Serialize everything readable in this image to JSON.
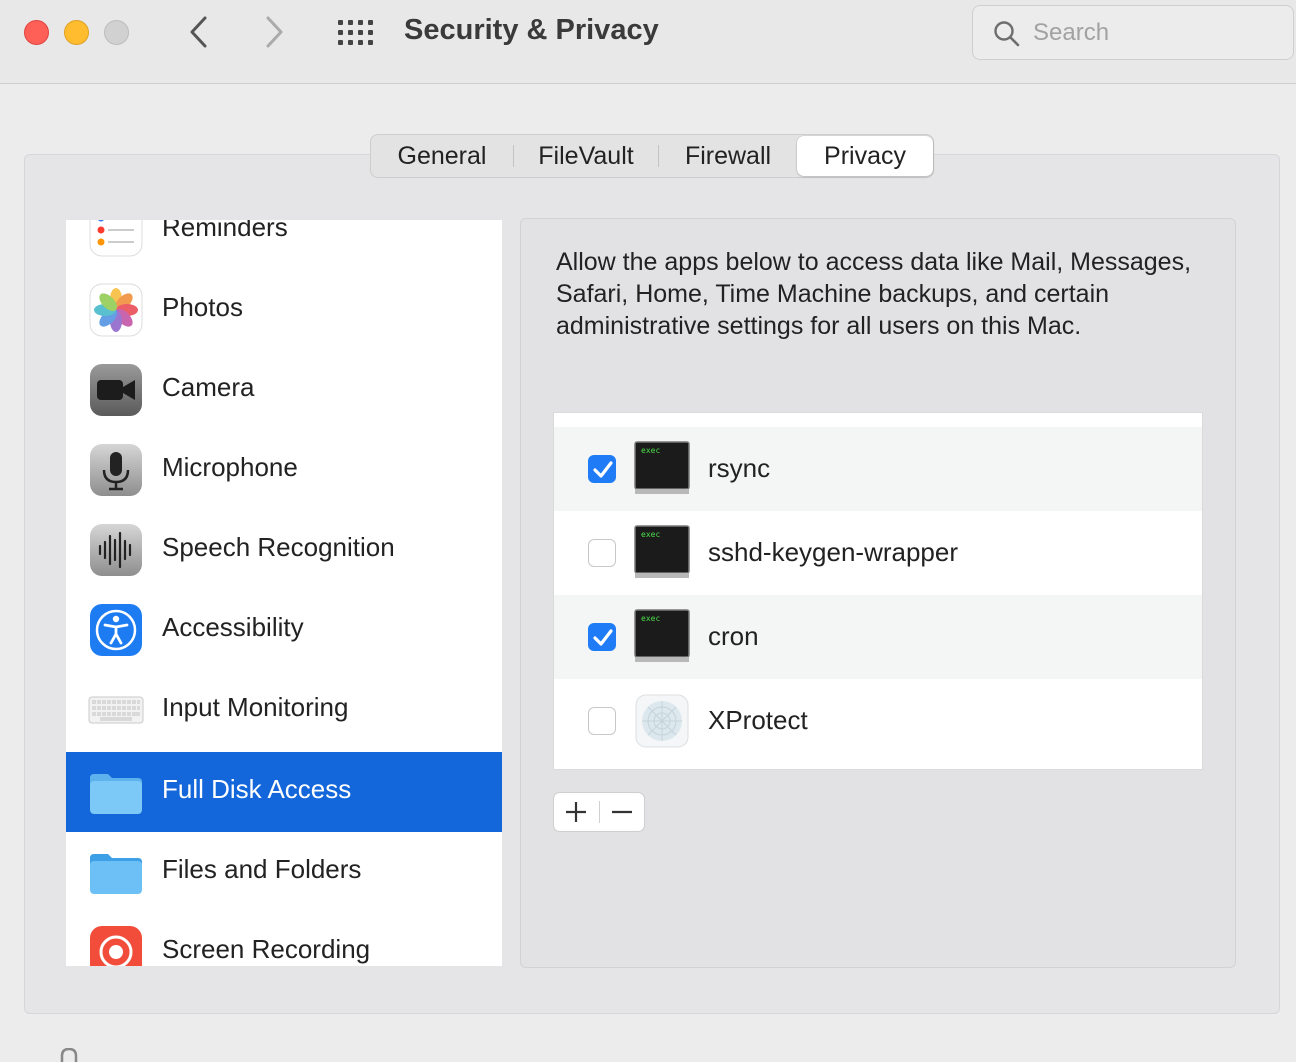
{
  "window": {
    "title": "Security & Privacy",
    "search_placeholder": "Search"
  },
  "tabs": [
    {
      "label": "General"
    },
    {
      "label": "FileVault"
    },
    {
      "label": "Firewall"
    },
    {
      "label": "Privacy",
      "selected": true
    }
  ],
  "sidebar": {
    "selected": "Full Disk Access",
    "items": [
      {
        "label": "Reminders",
        "icon": "reminders-icon"
      },
      {
        "label": "Photos",
        "icon": "photos-icon"
      },
      {
        "label": "Camera",
        "icon": "camera-icon"
      },
      {
        "label": "Microphone",
        "icon": "microphone-icon"
      },
      {
        "label": "Speech Recognition",
        "icon": "speech-recognition-icon"
      },
      {
        "label": "Accessibility",
        "icon": "accessibility-icon"
      },
      {
        "label": "Input Monitoring",
        "icon": "keyboard-icon"
      },
      {
        "label": "Full Disk Access",
        "icon": "folder-icon"
      },
      {
        "label": "Files and Folders",
        "icon": "folder-icon"
      },
      {
        "label": "Screen Recording",
        "icon": "screen-recording-icon"
      }
    ]
  },
  "privacy": {
    "description": "Allow the apps below to access data like Mail, Messages, Safari, Home, Time Machine backups, and certain administrative settings for all users on this Mac.",
    "apps": [
      {
        "name": "rsync",
        "checked": true,
        "icon": "exec-icon",
        "icon_text": "exec"
      },
      {
        "name": "sshd-keygen-wrapper",
        "checked": false,
        "icon": "exec-icon",
        "icon_text": "exec"
      },
      {
        "name": "cron",
        "checked": true,
        "icon": "exec-icon",
        "icon_text": "exec"
      },
      {
        "name": "XProtect",
        "checked": false,
        "icon": "xprotect-icon"
      }
    ]
  },
  "colors": {
    "accent": "#1367da",
    "checkbox": "#1f7cf6",
    "close": "#fe5f57",
    "minimize": "#febc2e"
  }
}
